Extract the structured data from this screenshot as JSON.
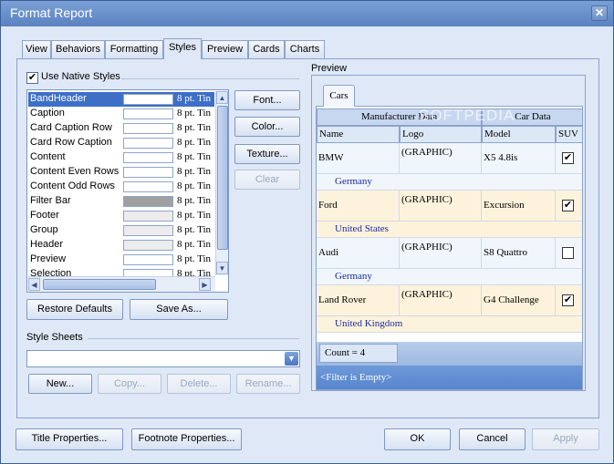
{
  "window": {
    "title": "Format Report",
    "close_glyph": "✕"
  },
  "tabs": [
    {
      "label": "View"
    },
    {
      "label": "Behaviors"
    },
    {
      "label": "Formatting"
    },
    {
      "label": "Styles"
    },
    {
      "label": "Preview"
    },
    {
      "label": "Cards"
    },
    {
      "label": "Charts"
    }
  ],
  "active_tab": "Styles",
  "styles": {
    "use_native_label": "Use Native Styles",
    "use_native_checked": true,
    "items": [
      {
        "name": "BandHeader",
        "font": "8 pt. Tin",
        "swatch": "#ffffff",
        "selected": true
      },
      {
        "name": "Caption",
        "font": "8 pt. Tin",
        "swatch": "#ffffff"
      },
      {
        "name": "Card Caption Row",
        "font": "8 pt. Tin",
        "swatch": "#ffffff"
      },
      {
        "name": "Card Row Caption",
        "font": "8 pt. Tin",
        "swatch": "#ffffff"
      },
      {
        "name": "Content",
        "font": "8 pt. Tin",
        "swatch": "#ffffff"
      },
      {
        "name": "Content Even Rows",
        "font": "8 pt. Tin",
        "swatch": "#ffffff"
      },
      {
        "name": "Content Odd Rows",
        "font": "8 pt. Tin",
        "swatch": "#ffffff"
      },
      {
        "name": "Filter Bar",
        "font": "8 pt. Tin",
        "swatch": "#a0a0a0"
      },
      {
        "name": "Footer",
        "font": "8 pt. Tin",
        "swatch": "#ececec"
      },
      {
        "name": "Group",
        "font": "8 pt. Tin",
        "swatch": "#ececec"
      },
      {
        "name": "Header",
        "font": "8 pt. Tin",
        "swatch": "#ececec"
      },
      {
        "name": "Preview",
        "font": "8 pt. Tin",
        "swatch": "#ffffff"
      },
      {
        "name": "Selection",
        "font": "8 pt. Tin",
        "swatch": "#ffffff"
      }
    ],
    "buttons": {
      "font": "Font...",
      "color": "Color...",
      "texture": "Texture...",
      "clear": "Clear",
      "restore": "Restore Defaults",
      "save_as": "Save As..."
    }
  },
  "style_sheets": {
    "label": "Style Sheets",
    "selected": "",
    "buttons": {
      "new": "New...",
      "copy": "Copy...",
      "delete": "Delete...",
      "rename": "Rename..."
    }
  },
  "preview": {
    "label": "Preview",
    "tab": "Cars",
    "bands": [
      "Manufacturer Data",
      "Car Data"
    ],
    "columns": [
      "Name",
      "Logo",
      "Model",
      "SUV"
    ],
    "rows": [
      {
        "name": "BMW",
        "logo": "(GRAPHIC)",
        "model": "X5 4.8is",
        "suv": true,
        "country": "Germany",
        "shade": "#f0f6fb"
      },
      {
        "name": "Ford",
        "logo": "(GRAPHIC)",
        "model": "Excursion",
        "suv": true,
        "country": "United States",
        "shade": "#fdf3dc"
      },
      {
        "name": "Audi",
        "logo": "(GRAPHIC)",
        "model": "S8 Quattro",
        "suv": false,
        "country": "Germany",
        "shade": "#f0f6fb"
      },
      {
        "name": "Land Rover",
        "logo": "(GRAPHIC)",
        "model": "G4 Challenge",
        "suv": true,
        "country": "United Kingdom",
        "shade": "#fdf3dc"
      }
    ],
    "count": "Count = 4",
    "filter": "<Filter is Empty>",
    "watermark": "SOFTPEDIA"
  },
  "footer_buttons": {
    "title_props": "Title Properties...",
    "footnote_props": "Footnote Properties...",
    "ok": "OK",
    "cancel": "Cancel",
    "apply": "Apply"
  },
  "icons": {
    "check": "✔",
    "up": "▲",
    "down": "▼",
    "left": "◀",
    "right": "▶",
    "combo_down": "⌄",
    "grip": "≡"
  }
}
